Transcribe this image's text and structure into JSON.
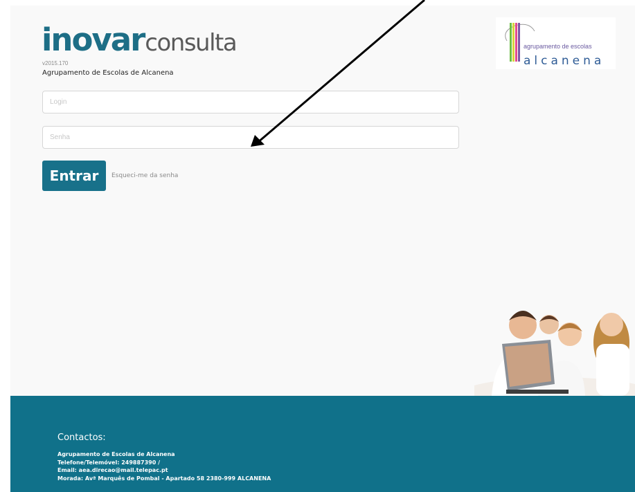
{
  "header": {
    "brand_strong": "inovar",
    "brand_light": "consulta",
    "version": "v2015.170",
    "school_name": "Agrupamento de Escolas de Alcanena"
  },
  "school_logo": {
    "line1": "agrupamento de escolas",
    "line2": "alcanena",
    "stripe_colors": [
      "#6cbd45",
      "#d7d43c",
      "#e44b8d",
      "#7d56a6"
    ]
  },
  "form": {
    "login_placeholder": "Login",
    "password_placeholder": "Senha",
    "submit_label": "Entrar",
    "forgot_label": "Esqueci-me da senha"
  },
  "footer": {
    "title": "Contactos:",
    "lines": [
      "Agrupamento de Escolas de Alcanena",
      "Telefone/Telemóvel: 249887390 /",
      "Email: aea.direcao@mail.telepac.pt",
      "Morada: Avª Marquês de Pombal - Apartado 58 2380-999 ALCANENA"
    ]
  },
  "colors": {
    "accent": "#18718a",
    "footer": "#10718a",
    "page_bg": "#f9f9f9"
  }
}
